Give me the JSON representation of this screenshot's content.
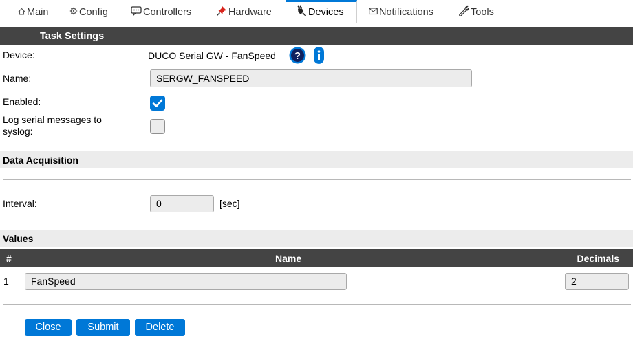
{
  "tabs": [
    {
      "label": "Main",
      "icon": "home-icon"
    },
    {
      "label": "Config",
      "icon": "gear-icon"
    },
    {
      "label": "Controllers",
      "icon": "message-icon"
    },
    {
      "label": "Hardware",
      "icon": "pushpin-icon"
    },
    {
      "label": "Devices",
      "icon": "plug-icon",
      "active": true
    },
    {
      "label": "Notifications",
      "icon": "envelope-icon"
    },
    {
      "label": "Tools",
      "icon": "wrench-icon"
    }
  ],
  "task_settings": {
    "title": "Task Settings",
    "device_label": "Device:",
    "device_value": "DUCO Serial GW - FanSpeed",
    "name_label": "Name:",
    "name_value": "SERGW_FANSPEED",
    "enabled_label": "Enabled:",
    "enabled": true,
    "log_label": "Log serial messages to syslog:",
    "log_enabled": false
  },
  "data_acquisition": {
    "title": "Data Acquisition",
    "interval_label": "Interval:",
    "interval_value": "0",
    "interval_unit": "[sec]"
  },
  "values": {
    "title": "Values",
    "columns": {
      "index": "#",
      "name": "Name",
      "decimals": "Decimals"
    },
    "rows": [
      {
        "index": "1",
        "name": "FanSpeed",
        "decimals": "2"
      }
    ]
  },
  "buttons": {
    "close": "Close",
    "submit": "Submit",
    "delete": "Delete"
  },
  "colors": {
    "accent": "#0078d7",
    "header_dark": "#444444",
    "header_light": "#ececec"
  }
}
